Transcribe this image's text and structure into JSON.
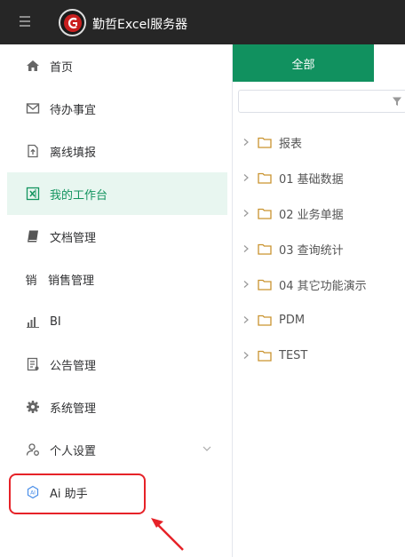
{
  "app": {
    "title": "勤哲Excel服务器"
  },
  "sidebar": {
    "items": [
      {
        "label": "首页",
        "icon": "home-icon"
      },
      {
        "label": "待办事宜",
        "icon": "mail-icon"
      },
      {
        "label": "离线填报",
        "icon": "upload-file-icon"
      },
      {
        "label": "我的工作台",
        "icon": "excel-icon",
        "active": true
      },
      {
        "label": "文档管理",
        "icon": "book-icon"
      },
      {
        "label": "销售管理",
        "icon": "xiao-char-icon",
        "icon_text": "销"
      },
      {
        "label": "BI",
        "icon": "bar-chart-icon"
      },
      {
        "label": "公告管理",
        "icon": "notice-icon"
      },
      {
        "label": "系统管理",
        "icon": "gear-icon"
      },
      {
        "label": "个人设置",
        "icon": "user-settings-icon"
      },
      {
        "label": "Ai 助手",
        "icon": "ai-icon"
      }
    ]
  },
  "panel": {
    "tab_label": "全部",
    "search_placeholder": "",
    "tree": [
      {
        "label": "报表"
      },
      {
        "label": "01 基础数据"
      },
      {
        "label": "02 业务单据"
      },
      {
        "label": "03 查询统计"
      },
      {
        "label": "04 其它功能演示"
      },
      {
        "label": "PDM"
      },
      {
        "label": "TEST"
      }
    ]
  },
  "colors": {
    "accent": "#11915f",
    "active_bg": "#e8f6f0",
    "topbar": "#262626",
    "highlight": "#e62228",
    "folder": "#c9932f"
  }
}
